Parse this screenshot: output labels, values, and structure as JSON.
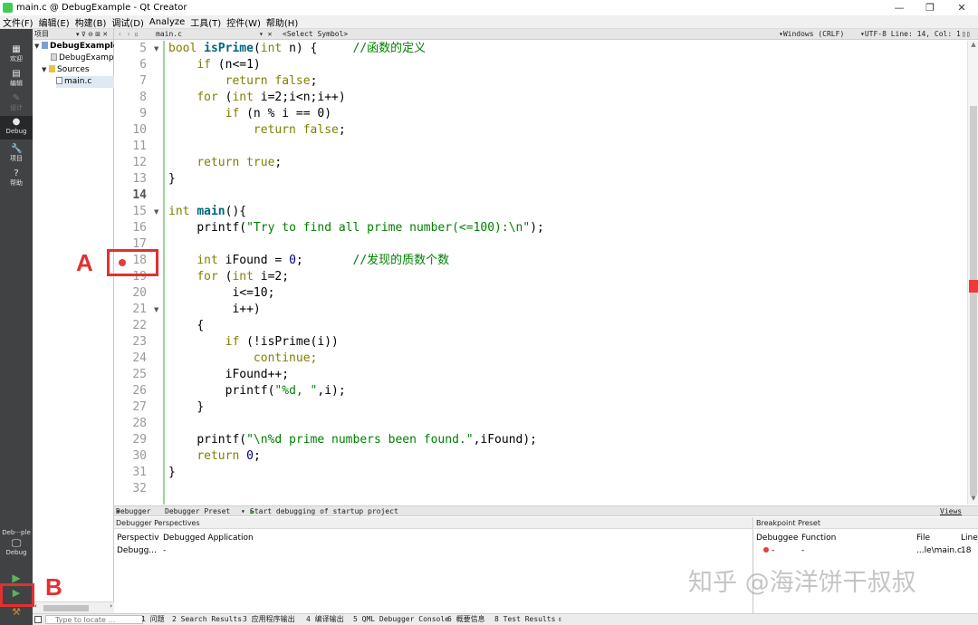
{
  "window": {
    "title": "main.c @ DebugExample - Qt Creator",
    "controls": [
      "—",
      "❐",
      "✕"
    ]
  },
  "menu": [
    "文件(F)",
    "编辑(E)",
    "构建(B)",
    "调试(D)",
    "Analyze",
    "工具(T)",
    "控件(W)",
    "帮助(H)"
  ],
  "modes": [
    {
      "label": "欢迎",
      "icon": "welcome-icon"
    },
    {
      "label": "编辑",
      "icon": "edit-icon"
    },
    {
      "label": "设计",
      "icon": "design-icon"
    },
    {
      "label": "Debug",
      "icon": "debug-icon"
    },
    {
      "label": "项目",
      "icon": "projects-icon"
    },
    {
      "label": "帮助",
      "icon": "help-icon"
    }
  ],
  "kit": {
    "label": "Deb···ple",
    "sublabel": "Debug"
  },
  "project_panel": {
    "header": "项目",
    "tree": [
      {
        "label": "DebugExample",
        "bold": true
      },
      {
        "label": "DebugExample.pro"
      },
      {
        "label": "Sources"
      },
      {
        "label": "main.c"
      }
    ]
  },
  "editor_toolbar": {
    "file": "main.c",
    "symbol": "<Select Symbol>",
    "line_ending": "Windows (CRLF)",
    "encoding_pos": "UTF-8 Line: 14, Col: 1"
  },
  "code_lines": [
    {
      "n": "5",
      "fold": true
    },
    {
      "n": "6"
    },
    {
      "n": "7"
    },
    {
      "n": "8"
    },
    {
      "n": "9"
    },
    {
      "n": "10"
    },
    {
      "n": "11"
    },
    {
      "n": "12"
    },
    {
      "n": "13"
    },
    {
      "n": "14",
      "current": true
    },
    {
      "n": "15",
      "fold": true
    },
    {
      "n": "16"
    },
    {
      "n": "17"
    },
    {
      "n": "18",
      "breakpoint": true
    },
    {
      "n": "19"
    },
    {
      "n": "20"
    },
    {
      "n": "21",
      "fold": true
    },
    {
      "n": "22"
    },
    {
      "n": "23"
    },
    {
      "n": "24"
    },
    {
      "n": "25"
    },
    {
      "n": "26"
    },
    {
      "n": "27"
    },
    {
      "n": "28"
    },
    {
      "n": "29"
    },
    {
      "n": "30"
    },
    {
      "n": "31"
    },
    {
      "n": "32"
    }
  ],
  "code": {
    "l5": {
      "kw1": "bool",
      "fn": "isPrime",
      "p1": "(",
      "kw2": "int",
      "p2": " n) {",
      "cm": "//函数的定义"
    },
    "l6": {
      "kw": "if",
      "rest": " (n<=1)"
    },
    "l7": {
      "kw": "return",
      "kw2": "false",
      "rest": ";"
    },
    "l8": {
      "kw": "for",
      "p1": " (",
      "kw2": "int",
      "rest": " i=2;i<n;i++)"
    },
    "l9": {
      "kw": "if",
      "rest": " (n % i == 0)"
    },
    "l10": {
      "kw": "return",
      "kw2": "false",
      "rest": ";"
    },
    "l12": {
      "kw": "return",
      "kw2": "true",
      "rest": ";"
    },
    "l13": "}",
    "l15": {
      "kw": "int",
      "fn": "main",
      "rest": "(){"
    },
    "l16": {
      "rest": "printf(",
      "str": "\"Try to find all prime number(<=100):\\n\"",
      "end": ");"
    },
    "l18": {
      "kw": "int",
      "rest": " iFound = ",
      "num": "0",
      "end": ";",
      "cm": "//发现的质数个数"
    },
    "l19": {
      "kw": "for",
      "p1": " (",
      "kw2": "int",
      "rest": " i=2;"
    },
    "l20": "i<=10;",
    "l21": "i++)",
    "l22": "{",
    "l23": {
      "kw": "if",
      "rest": " (!isPrime(i))"
    },
    "l24": "continue;",
    "l25": "iFound++;",
    "l26": {
      "rest": "printf(",
      "str": "\"%d, \"",
      "end": ",i);"
    },
    "l27": "}",
    "l29": {
      "rest": "printf(",
      "str": "\"\\n%d prime numbers been found.\"",
      "end": ",iFound);"
    },
    "l30": {
      "kw": "return",
      "num": "0",
      "end": ";"
    },
    "l31": "}"
  },
  "annotations": {
    "a": "A",
    "b": "B"
  },
  "debugger_bar": {
    "debugger": "Debugger",
    "preset": "Debugger Preset",
    "start": "Start debugging of startup project",
    "views": "Views"
  },
  "perspectives": {
    "header": "Debugger Perspectives",
    "col1": "Perspectiv",
    "col2": "Debugged Application",
    "row_col1": "Debugg...",
    "row_col2": "-"
  },
  "breakpoints": {
    "header": "Breakpoint Preset",
    "cols": [
      "Debuggee",
      "Function",
      "File",
      "Line"
    ],
    "row": [
      "-",
      "-",
      "...le\\main.c",
      "18"
    ]
  },
  "statusbar": {
    "locate_placeholder": "Type to locate ...",
    "tabs": [
      "1 问题",
      "2 Search Results",
      "3 应用程序输出",
      "4 编译输出",
      "5 QML Debugger Console",
      "6 概要信息",
      "8 Test Results"
    ]
  },
  "watermark": "知乎 @海洋饼干叔叔",
  "colors": {
    "accent_red": "#e23030",
    "breakpoint": "#e04040",
    "run_green": "#59b35a"
  }
}
